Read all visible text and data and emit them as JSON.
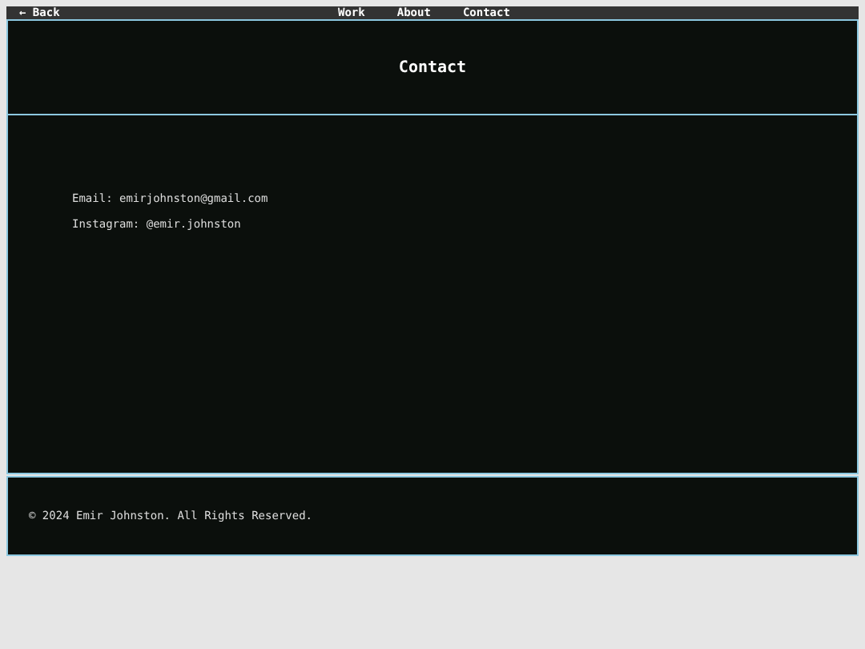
{
  "nav": {
    "back": "← Back",
    "links": [
      "Work",
      "About",
      "Contact"
    ]
  },
  "header": {
    "title": "Contact"
  },
  "contact": {
    "lines": [
      "Email: emirjohnston@gmail.com",
      "Instagram: @emir.johnston"
    ]
  },
  "footer": {
    "text": "© 2024 Emir Johnston. All Rights Reserved."
  }
}
